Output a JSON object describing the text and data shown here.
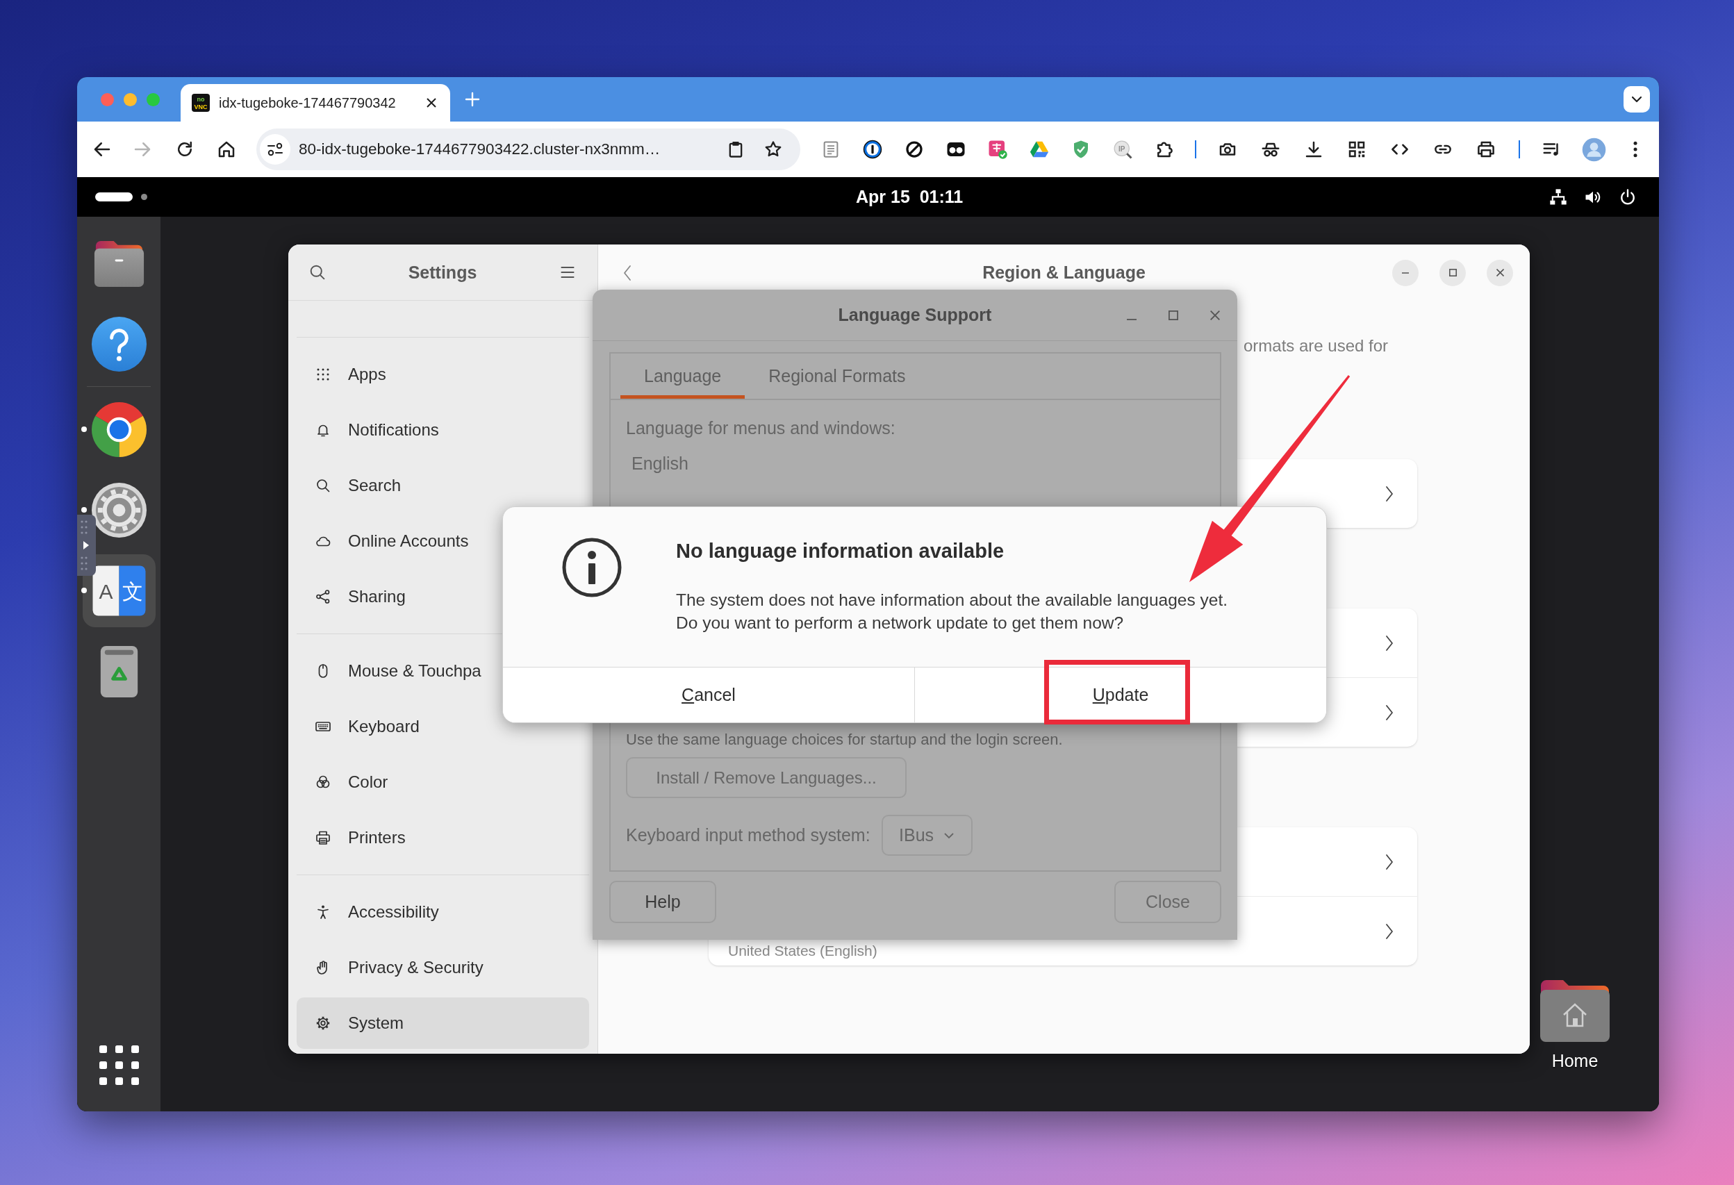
{
  "browser": {
    "tabs": [
      {
        "title": "idx-tugeboke-174467790342",
        "favicon_text": [
          "no",
          "VNC"
        ],
        "selected": true
      }
    ],
    "forward_disabled": true,
    "address_bar": {
      "value": "80-idx-tugeboke-1744677903422.cluster-nx3nmm…"
    },
    "extension_label": "IP"
  },
  "top_bar": {
    "workspaces": [
      {
        "selected": true
      },
      {
        "selected": false
      }
    ],
    "clock": "Apr 15  01:11"
  },
  "dock": {
    "groups": [
      [
        {
          "kind": "files",
          "running": false,
          "selected": false
        },
        {
          "kind": "help",
          "running": false,
          "selected": false
        }
      ],
      [
        {
          "kind": "browser",
          "running": true,
          "selected": false
        },
        {
          "kind": "settings",
          "running": true,
          "selected": false
        },
        {
          "kind": "language",
          "running": true,
          "selected": true,
          "glyphs": [
            "A",
            "文"
          ]
        },
        {
          "kind": "trash",
          "running": false,
          "selected": false
        }
      ]
    ]
  },
  "settings": {
    "sidebar": {
      "title": "Settings",
      "groups": [
        [
          {
            "label": "Apps",
            "selected": false
          },
          {
            "label": "Notifications",
            "selected": false
          },
          {
            "label": "Search",
            "selected": false
          },
          {
            "label": "Online Accounts",
            "selected": false
          },
          {
            "label": "Sharing",
            "selected": false
          }
        ],
        [
          {
            "label": "Mouse & Touchpa",
            "selected": false
          },
          {
            "label": "Keyboard",
            "selected": false
          },
          {
            "label": "Color",
            "selected": false
          },
          {
            "label": "Printers",
            "selected": false
          }
        ],
        [
          {
            "label": "Accessibility",
            "selected": false
          },
          {
            "label": "Privacy & Security",
            "selected": false
          },
          {
            "label": "System",
            "selected": true
          }
        ]
      ]
    },
    "panel": {
      "title": "Region & Language",
      "description": "ormats are used for",
      "cards": [
        {
          "rows": [
            {
              "kind": "link"
            }
          ]
        },
        {
          "rows": [
            {
              "kind": "link"
            },
            {
              "kind": "link"
            }
          ]
        },
        {
          "rows": [
            {
              "kind": "link"
            },
            {
              "kind": "link",
              "subtitle": "United States (English)"
            }
          ]
        }
      ]
    }
  },
  "language_support": {
    "title": "Language Support",
    "tabs": [
      {
        "label": "Language",
        "selected": true
      },
      {
        "label": "Regional Formats",
        "selected": false
      }
    ],
    "heading": "Language for menus and windows:",
    "languages": [
      "English"
    ],
    "note": "Use the same language choices for startup and the login screen.",
    "install_button": {
      "label": "Install / Remove Languages...",
      "disabled": true
    },
    "input_method": {
      "label": "Keyboard input method system:",
      "value": "IBus",
      "disabled": true
    },
    "buttons": [
      {
        "label": "Help",
        "disabled": false
      },
      {
        "label": "Close",
        "disabled": true
      }
    ]
  },
  "alert": {
    "title": "No language information available",
    "message": [
      "The system does not have information about the available languages yet.",
      "Do you want to perform a network update to get them now?"
    ],
    "buttons": [
      {
        "label": "Cancel",
        "mnemonic": true
      },
      {
        "label": "Update",
        "mnemonic": true
      }
    ]
  },
  "desktop_icons": [
    {
      "label": "Home"
    }
  ]
}
